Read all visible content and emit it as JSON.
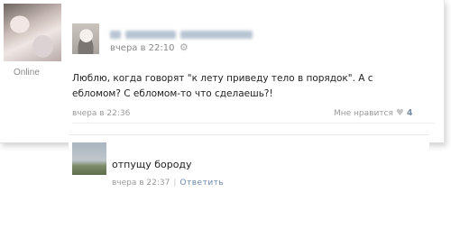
{
  "post": {
    "online_label": "Online",
    "date": "вчера в 22:10",
    "text": "Люблю, когда говорят \"к лету приведу тело в порядок\". А с ебломом? С ебломом-то что сделаешь?!",
    "comment_date": "вчера в 22:36",
    "like_label": "Мне нравится",
    "like_count": "4"
  },
  "reply": {
    "text": "отпущу бороду",
    "date": "вчера в 22:37",
    "reply_link": "Ответить"
  }
}
